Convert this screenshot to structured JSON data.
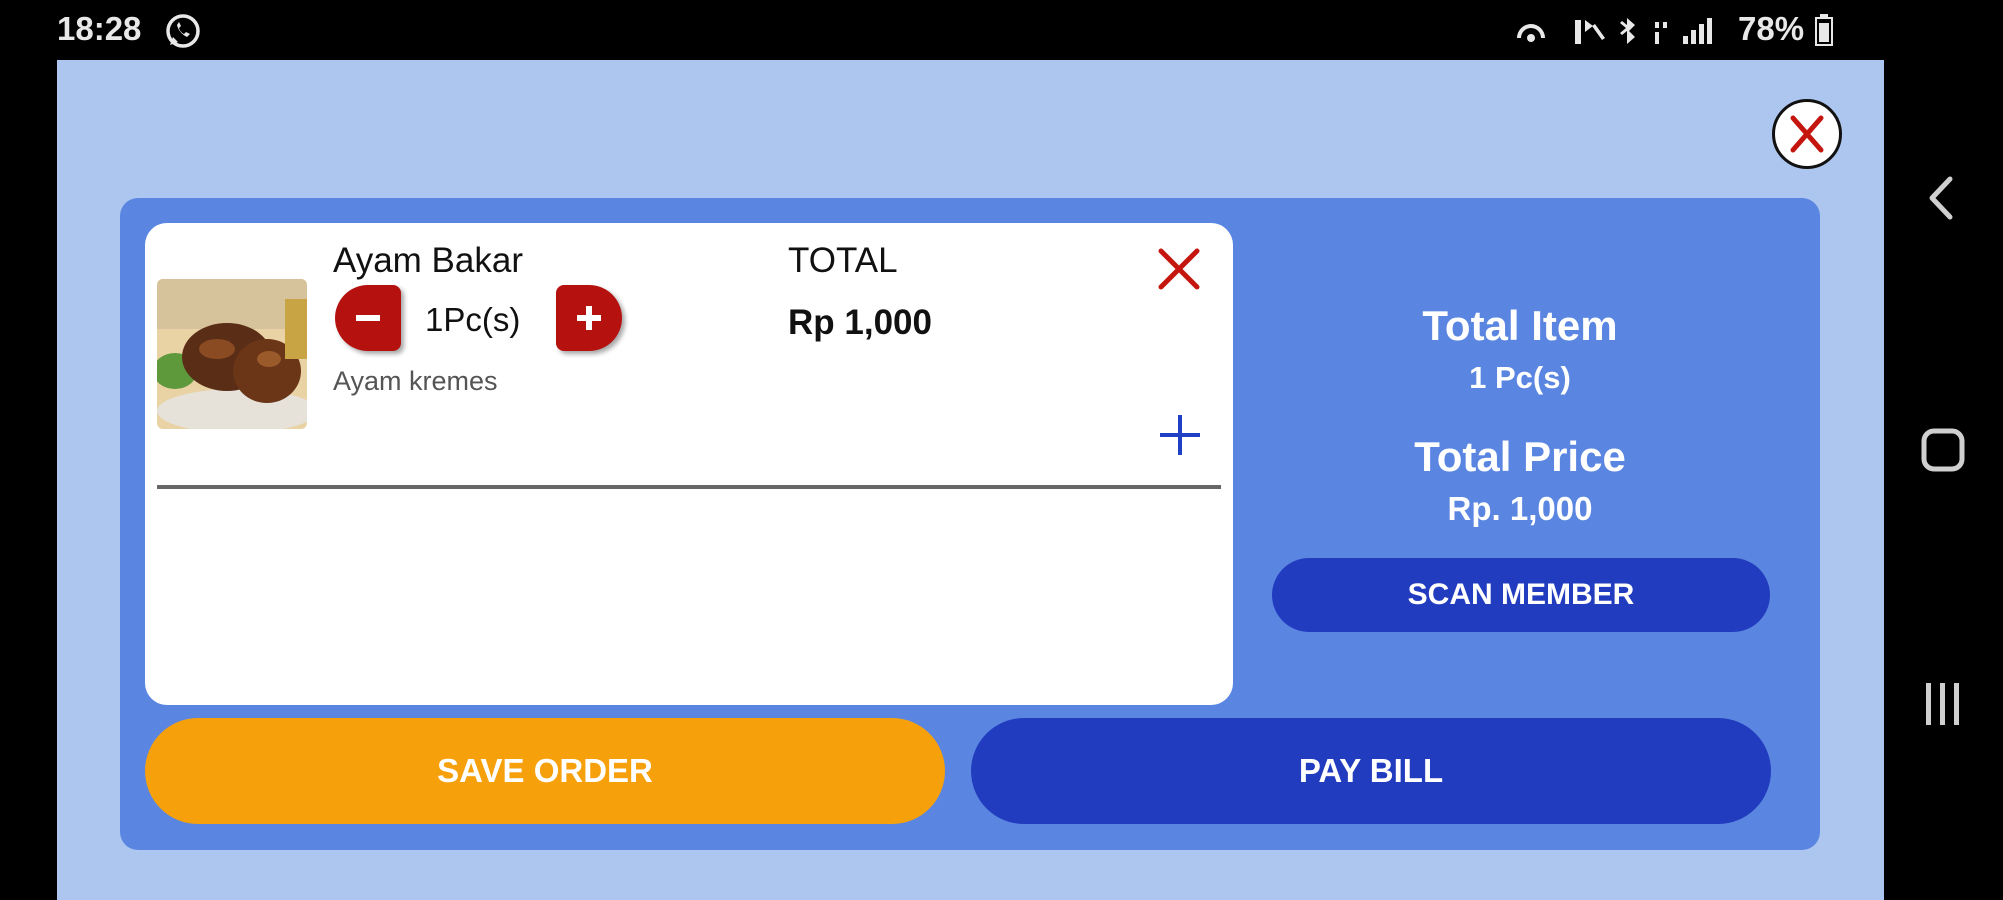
{
  "status_bar": {
    "time": "18:28",
    "battery": "78%"
  },
  "cart": {
    "item": {
      "name": "Ayam Bakar",
      "quantity": "1Pc(s)",
      "note": "Ayam kremes",
      "total_label": "TOTAL",
      "total_value": "Rp 1,000"
    }
  },
  "summary": {
    "total_item_label": "Total Item",
    "total_item_value": "1 Pc(s)",
    "total_price_label": "Total Price",
    "total_price_value": "Rp. 1,000"
  },
  "buttons": {
    "scan_member": "SCAN MEMBER",
    "save_order": "SAVE ORDER",
    "pay_bill": "PAY BILL"
  },
  "colors": {
    "dialog_bg": "#adc6f0",
    "panel_bg": "#5a86e1",
    "primary": "#223cbf",
    "save": "#f6a00c",
    "danger": "#b5110f"
  }
}
